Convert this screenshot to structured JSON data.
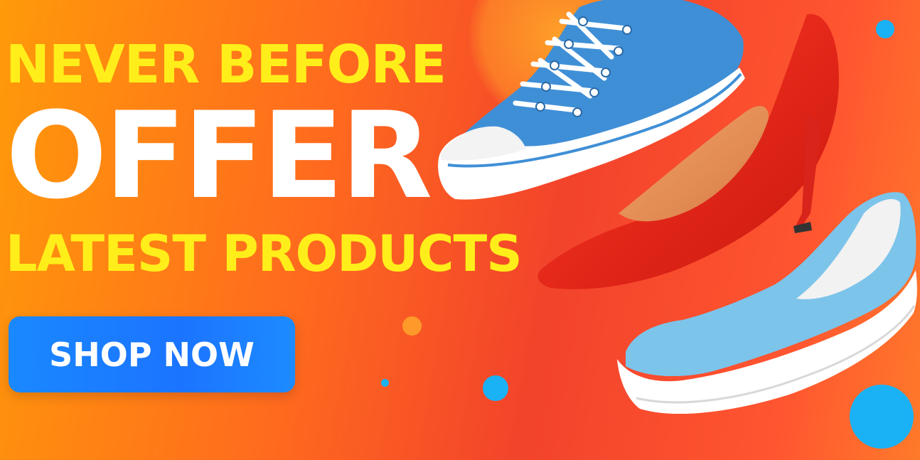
{
  "banner": {
    "headline_top": "NEVER BEFORE",
    "headline_main": "OFFER",
    "headline_bottom": "LATEST PRODUCTS",
    "cta_label": "SHOP NOW"
  },
  "colors": {
    "headline_yellow": "#ffee1a",
    "headline_white": "#ffffff",
    "cta_blue": "#1b74ff",
    "sneaker_blue": "#3f8fd6",
    "heel_red": "#e8261a",
    "slipon_blue": "#7cc4ea",
    "dot_blue": "#1ab2f5",
    "dot_orange": "#ff9a2a"
  },
  "products": [
    {
      "icon": "blue-sneaker-icon"
    },
    {
      "icon": "red-high-heel-icon"
    },
    {
      "icon": "light-blue-slip-on-icon"
    }
  ]
}
